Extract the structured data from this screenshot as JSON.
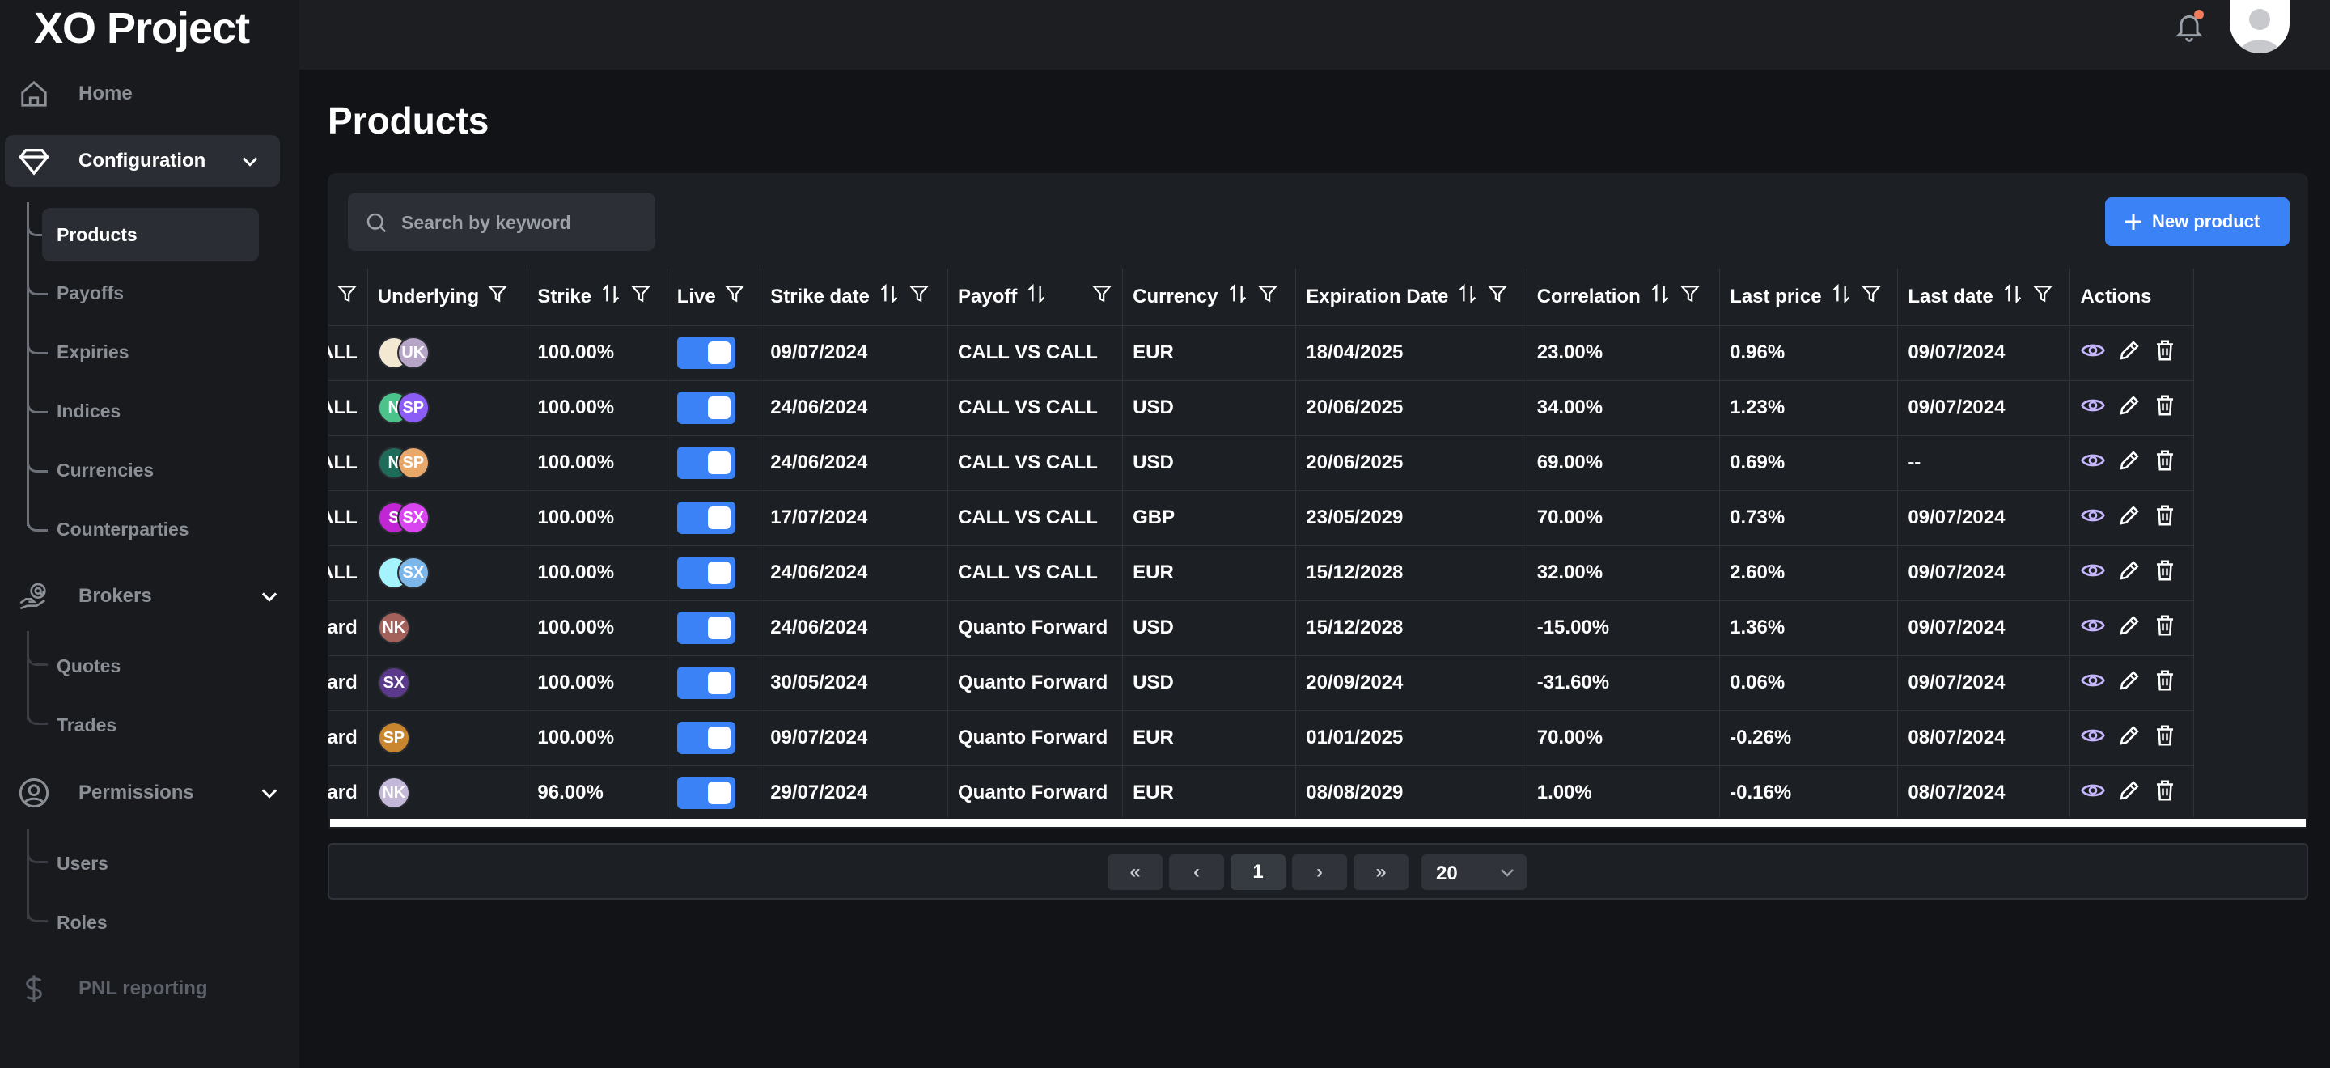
{
  "app": {
    "title": "XO Project"
  },
  "sidebar": {
    "home": "Home",
    "configuration": {
      "label": "Configuration",
      "items": [
        "Products",
        "Payoffs",
        "Expiries",
        "Indices",
        "Currencies",
        "Counterparties"
      ]
    },
    "brokers": {
      "label": "Brokers",
      "items": [
        "Quotes",
        "Trades"
      ]
    },
    "permissions": {
      "label": "Permissions",
      "items": [
        "Users",
        "Roles"
      ]
    },
    "pnl": "PNL reporting"
  },
  "page": {
    "title": "Products"
  },
  "search": {
    "placeholder": "Search by keyword"
  },
  "new_product_label": "New product",
  "table": {
    "columns": {
      "underlying": "Underlying",
      "strike": "Strike",
      "live": "Live",
      "strike_date": "Strike date",
      "payoff": "Payoff",
      "currency": "Currency",
      "expiration_date": "Expiration Date",
      "correlation": "Correlation",
      "last_price": "Last price",
      "last_date": "Last date",
      "actions": "Actions"
    },
    "rows": [
      {
        "name": "S CALL",
        "avatars": [
          {
            "t": "",
            "c": "#f3e9d2"
          },
          {
            "t": "UK",
            "c": "#b7a5c8"
          }
        ],
        "strike": "100.00%",
        "live": true,
        "strike_date": "09/07/2024",
        "payoff": "CALL VS CALL",
        "currency": "EUR",
        "expiration_date": "18/04/2025",
        "correlation": "23.00%",
        "last_price": "0.96%",
        "last_date": "09/07/2024"
      },
      {
        "name": "S CALL",
        "avatars": [
          {
            "t": "N",
            "c": "#4cc38a"
          },
          {
            "t": "SP",
            "c": "#8b5cf6"
          }
        ],
        "strike": "100.00%",
        "live": true,
        "strike_date": "24/06/2024",
        "payoff": "CALL VS CALL",
        "currency": "USD",
        "expiration_date": "20/06/2025",
        "correlation": "34.00%",
        "last_price": "1.23%",
        "last_date": "09/07/2024"
      },
      {
        "name": "S CALL",
        "avatars": [
          {
            "t": "N",
            "c": "#1f6b5a"
          },
          {
            "t": "SP",
            "c": "#e8a86a"
          }
        ],
        "strike": "100.00%",
        "live": true,
        "strike_date": "24/06/2024",
        "payoff": "CALL VS CALL",
        "currency": "USD",
        "expiration_date": "20/06/2025",
        "correlation": "69.00%",
        "last_price": "0.69%",
        "last_date": "--"
      },
      {
        "name": "VS CALL",
        "avatars": [
          {
            "t": "S",
            "c": "#c026d3"
          },
          {
            "t": "SX",
            "c": "#d946ef"
          }
        ],
        "strike": "100.00%",
        "live": true,
        "strike_date": "17/07/2024",
        "payoff": "CALL VS CALL",
        "currency": "GBP",
        "expiration_date": "23/05/2029",
        "correlation": "70.00%",
        "last_price": "0.73%",
        "last_date": "09/07/2024"
      },
      {
        "name": "VS CALL",
        "avatars": [
          {
            "t": "",
            "c": "#a5f3fc"
          },
          {
            "t": "SX",
            "c": "#7db6e8"
          }
        ],
        "strike": "100.00%",
        "live": true,
        "strike_date": "24/06/2024",
        "payoff": "CALL VS CALL",
        "currency": "EUR",
        "expiration_date": "15/12/2028",
        "correlation": "32.00%",
        "last_price": "2.60%",
        "last_date": "09/07/2024"
      },
      {
        "name": "ward",
        "avatars": [
          {
            "t": "NK",
            "c": "#a4605a"
          }
        ],
        "strike": "100.00%",
        "live": true,
        "strike_date": "24/06/2024",
        "payoff": "Quanto Forward",
        "currency": "USD",
        "expiration_date": "15/12/2028",
        "correlation": "-15.00%",
        "last_price": "1.36%",
        "last_date": "09/07/2024"
      },
      {
        "name": "rward",
        "avatars": [
          {
            "t": "SX",
            "c": "#5b3a8c"
          }
        ],
        "strike": "100.00%",
        "live": true,
        "strike_date": "30/05/2024",
        "payoff": "Quanto Forward",
        "currency": "USD",
        "expiration_date": "20/09/2024",
        "correlation": "-31.60%",
        "last_price": "0.06%",
        "last_date": "09/07/2024"
      },
      {
        "name": "vard",
        "avatars": [
          {
            "t": "SP",
            "c": "#c9862e"
          }
        ],
        "strike": "100.00%",
        "live": true,
        "strike_date": "09/07/2024",
        "payoff": "Quanto Forward",
        "currency": "EUR",
        "expiration_date": "01/01/2025",
        "correlation": "70.00%",
        "last_price": "-0.26%",
        "last_date": "08/07/2024"
      },
      {
        "name": "vard",
        "avatars": [
          {
            "t": "NK",
            "c": "#c4b8d8"
          }
        ],
        "strike": "96.00%",
        "live": true,
        "strike_date": "29/07/2024",
        "payoff": "Quanto Forward",
        "currency": "EUR",
        "expiration_date": "08/08/2029",
        "correlation": "1.00%",
        "last_price": "-0.16%",
        "last_date": "08/07/2024"
      }
    ]
  },
  "pagination": {
    "first": "«",
    "prev": "‹",
    "current": "1",
    "next": "›",
    "last": "»",
    "page_size": "20"
  },
  "colors": {
    "accent": "#3b82f6",
    "background": "#111316",
    "card": "#1c1f23"
  }
}
